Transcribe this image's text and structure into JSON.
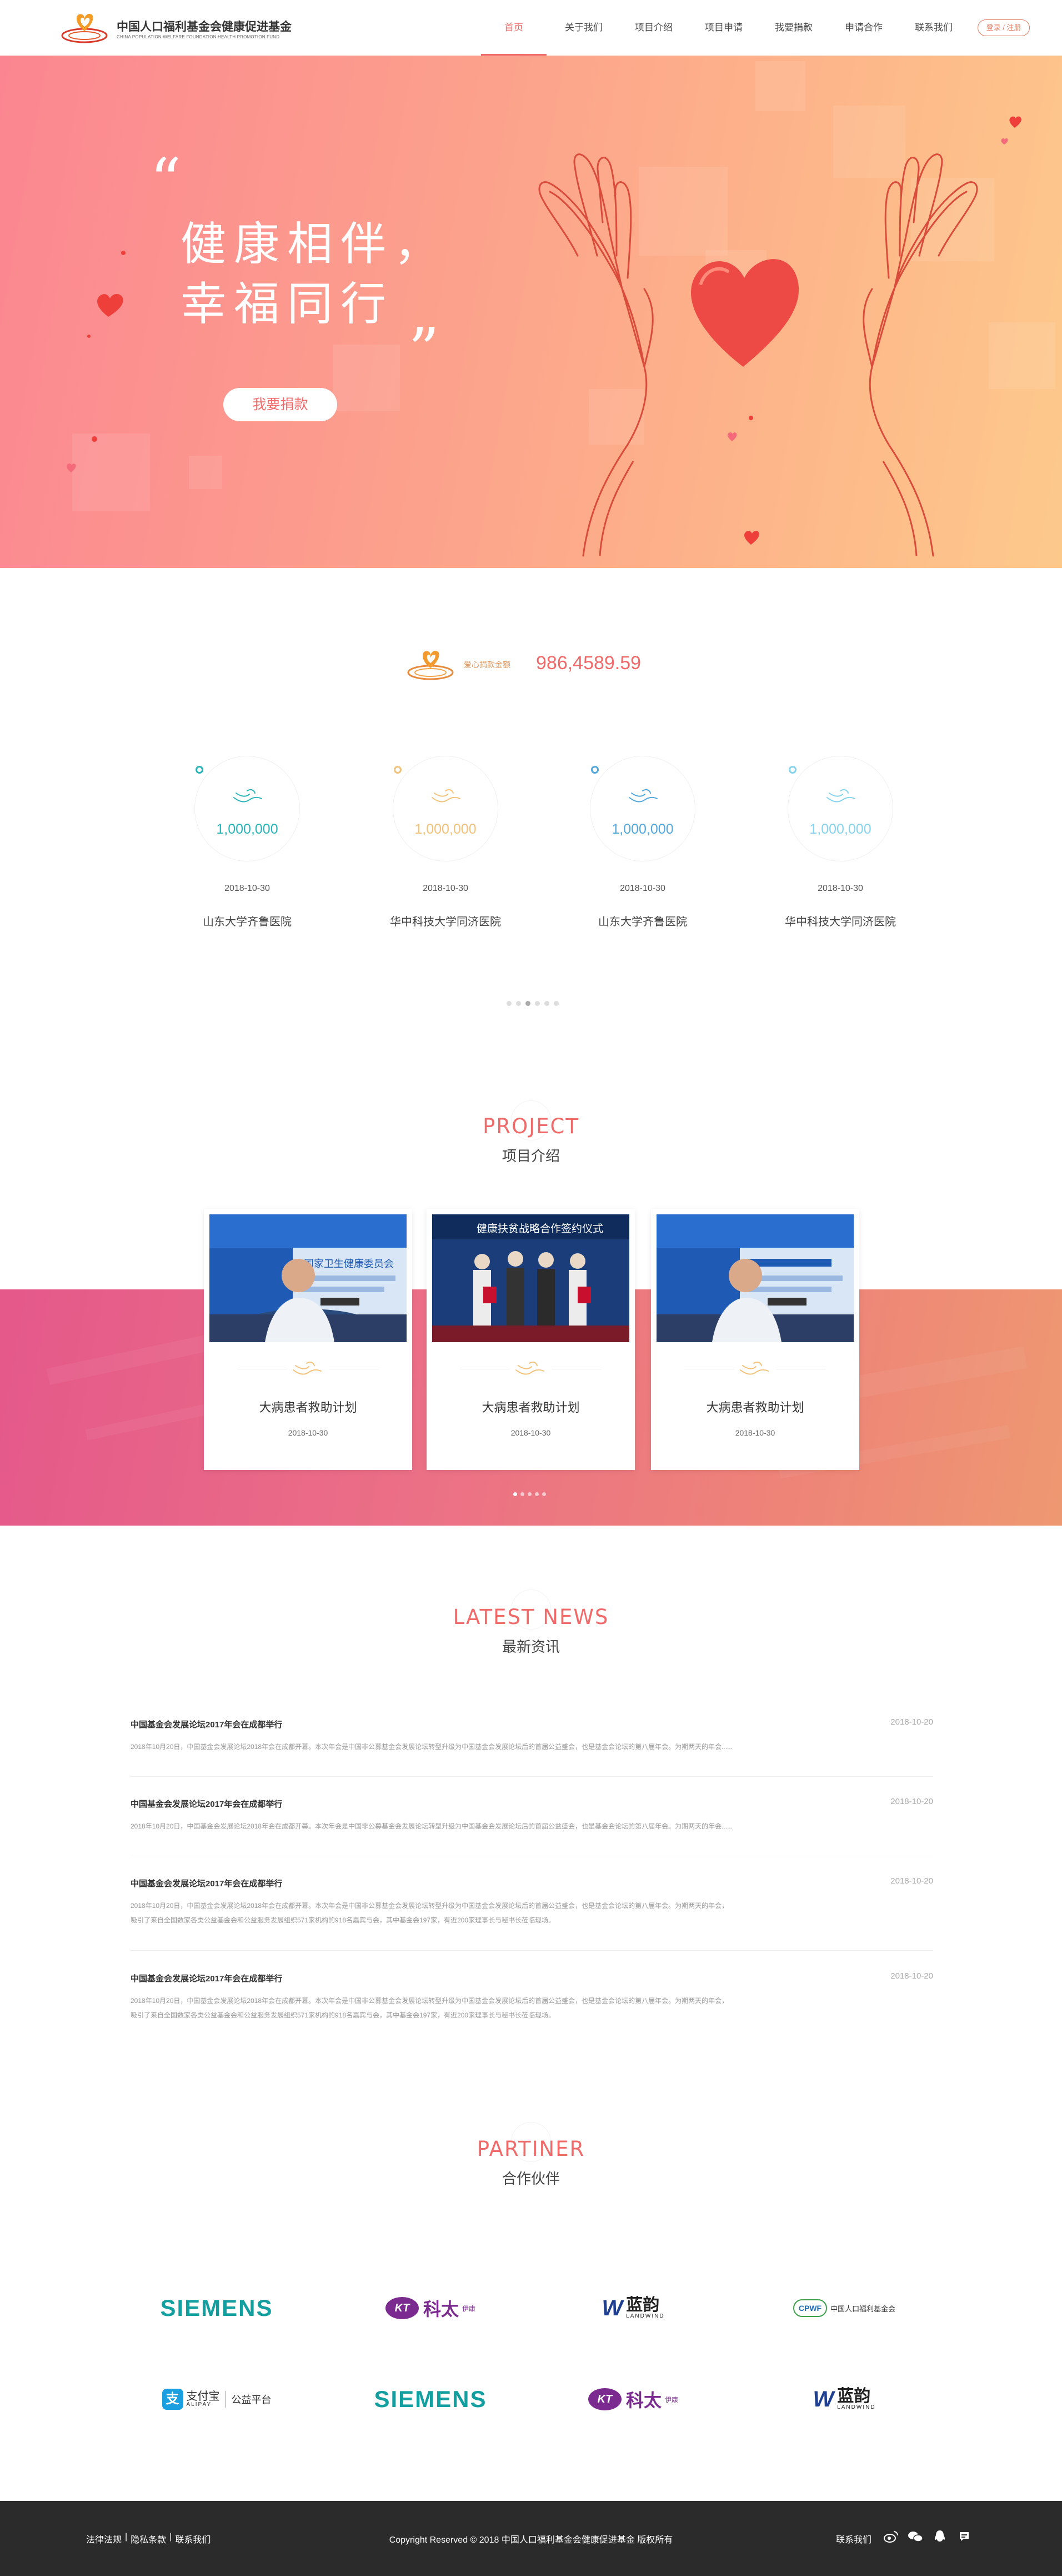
{
  "header": {
    "logo_cn": "中国人口福利基金会健康促进基金",
    "logo_en": "CHINA POPULATION WELFARE FOUNDATION HEALTH PROMOTION FUND",
    "nav": [
      "首页",
      "关于我们",
      "项目介绍",
      "项目申请",
      "我要捐款",
      "申请合作",
      "联系我们"
    ],
    "active_nav": "首页",
    "login": "登录 / 注册"
  },
  "hero": {
    "quote_open": "“",
    "quote_close": "”",
    "line1": "健康相伴，",
    "line2": "幸福同行",
    "donate_button": "我要捐款"
  },
  "donation_total": {
    "label": "爱心捐款金额",
    "value": "986,4589.59"
  },
  "hospitals": [
    {
      "amount": "1,000,000",
      "date": "2018-10-30",
      "name": "山东大学齐鲁医院",
      "color": "#29b4ba"
    },
    {
      "amount": "1,000,000",
      "date": "2018-10-30",
      "name": "华中科技大学同济医院",
      "color": "#f3c27a"
    },
    {
      "amount": "1,000,000",
      "date": "2018-10-30",
      "name": "山东大学齐鲁医院",
      "color": "#52a7dd"
    },
    {
      "amount": "1,000,000",
      "date": "2018-10-30",
      "name": "华中科技大学同济医院",
      "color": "#86d3ee"
    }
  ],
  "projects_section": {
    "title_en": "PROJECT",
    "title_cn": "项目介绍",
    "items": [
      {
        "name": "大病患者救助计划",
        "date": "2018-10-30",
        "photo": "speaker"
      },
      {
        "name": "大病患者救助计划",
        "date": "2018-10-30",
        "photo": "ceremony"
      },
      {
        "name": "大病患者救助计划",
        "date": "2018-10-30",
        "photo": "speaker"
      }
    ],
    "ceremony_banner": "健康扶贫战略合作签约仪式",
    "speaker_banner": "国家卫生健康委员会"
  },
  "news_section": {
    "title_en": "LATEST NEWS",
    "title_cn": "最新资讯",
    "items": [
      {
        "title": "中国基金会发展论坛2017年会在成都举行",
        "date": "2018-10-20",
        "body": "2018年10月20日，中国基金会发展论坛2018年会在成都开幕。本次年会是中国非公募基金会发展论坛转型升级为中国基金会发展论坛后的首届公益盛会，也是基金会论坛的第八届年会。为期两天的年会......"
      },
      {
        "title": "中国基金会发展论坛2017年会在成都举行",
        "date": "2018-10-20",
        "body": "2018年10月20日，中国基金会发展论坛2018年会在成都开幕。本次年会是中国非公募基金会发展论坛转型升级为中国基金会发展论坛后的首届公益盛会，也是基金会论坛的第八届年会。为期两天的年会......"
      },
      {
        "title": "中国基金会发展论坛2017年会在成都举行",
        "date": "2018-10-20",
        "body": "2018年10月20日，中国基金会发展论坛2018年会在成都开幕。本次年会是中国非公募基金会发展论坛转型升级为中国基金会发展论坛后的首届公益盛会，也是基金会论坛的第八届年会。为期两天的年会，",
        "body2": "吸引了来自全国数家各类公益基金会和公益服务发展组织571家机构的918名嘉宾与会，其中基金会197家，有近200家理事长与秘书长莅临现场。"
      },
      {
        "title": "中国基金会发展论坛2017年会在成都举行",
        "date": "2018-10-20",
        "body": "2018年10月20日，中国基金会发展论坛2018年会在成都开幕。本次年会是中国非公募基金会发展论坛转型升级为中国基金会发展论坛后的首届公益盛会，也是基金会论坛的第八届年会。为期两天的年会，",
        "body2": "吸引了来自全国数家各类公益基金会和公益服务发展组织571家机构的918名嘉宾与会，其中基金会197家，有近200家理事长与秘书长莅临现场。"
      }
    ]
  },
  "partners_section": {
    "title_en": "PARTINER",
    "title_cn": "合作伙伴",
    "siemens": "SIEMENS",
    "keda_badge": "KT",
    "keda_text": "科太",
    "keda_small": "伊康",
    "lanyun_text": "蓝韵",
    "lanyun_en": "LANDWIND",
    "cpwf_text": "中国人口福利基金会",
    "cpwf_badge": "CPWF",
    "alipay_text": "支付宝",
    "alipay_en": "ALIPAY",
    "alipay_sub": "公益平台"
  },
  "footer": {
    "links": [
      "法律法规",
      "隐私条款",
      "联系我们"
    ],
    "separator": "|",
    "copyright": "Copyright Reserved © 2018 中国人口福利基金会健康促进基金 版权所有",
    "contact_label": "联系我们"
  },
  "colors": {
    "accent": "#f06a6a",
    "footer_bg": "#2b2b2b"
  }
}
